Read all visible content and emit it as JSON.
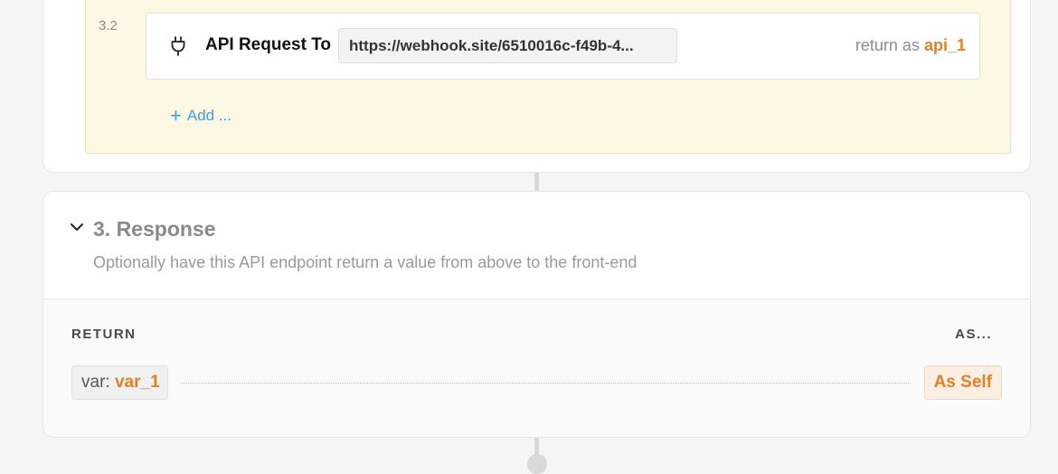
{
  "step": {
    "number": "3.2",
    "label": "API Request To",
    "url": "https://webhook.site/6510016c-f49b-4...",
    "return_prefix": "return as",
    "return_var": "api_1",
    "icon": "plug-icon"
  },
  "add_button": {
    "plus": "+",
    "label": "Add ..."
  },
  "response": {
    "title": "3. Response",
    "subtitle": "Optionally have this API endpoint return a value from above to the front-end",
    "return_header": "RETURN",
    "as_header": "AS...",
    "var_prefix": "var:",
    "var_value": "var_1",
    "as_value": "As Self"
  },
  "colors": {
    "accent_orange": "#e0812a",
    "link_blue": "#3ca0d8",
    "highlight_yellow": "#fdf8e4"
  }
}
